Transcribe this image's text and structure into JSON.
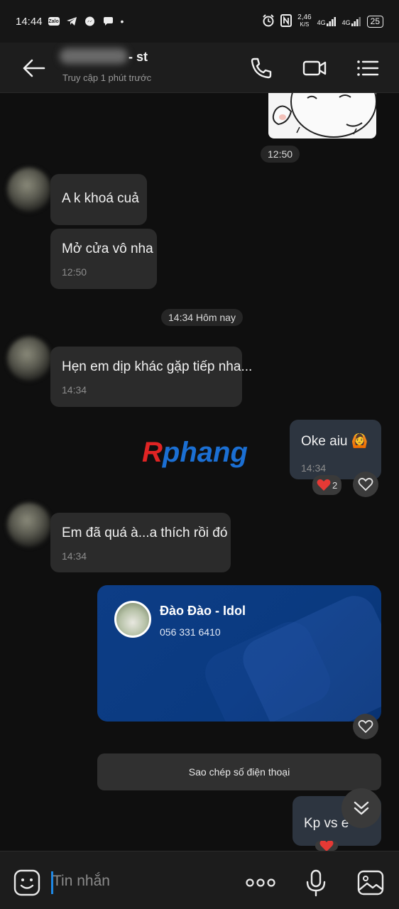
{
  "status_bar": {
    "time": "14:44",
    "net_speed_value": "2,46",
    "net_speed_unit": "K/S",
    "signal1": "4G",
    "signal2": "4G",
    "battery": "25"
  },
  "header": {
    "contact_name_suffix": "- st",
    "last_seen": "Truy cập 1 phút trước"
  },
  "messages": {
    "sticker_time": "12:50",
    "msg1_text": "A k khoá cuả",
    "msg2_text": "Mở cửa vô nha",
    "msg2_time": "12:50",
    "divider": "14:34 Hôm nay",
    "msg3_text": "Hẹn em dịp khác gặp tiếp nha...",
    "msg3_time": "14:34",
    "msg4_text": "Oke aiu",
    "msg4_emoji": "🙆",
    "msg4_time": "14:34",
    "msg4_reaction_count": "2",
    "msg5_text": "Em đã quá à...a thích rồi đó",
    "msg5_time": "14:34",
    "msg7_text": "Kp vs e"
  },
  "contact_card": {
    "name": "Đào Đào - Idol",
    "phone": "056 331 6410"
  },
  "copy_button": "Sao chép số điện thoại",
  "watermark": {
    "first": "R",
    "rest": "phang"
  },
  "input": {
    "placeholder": "Tin nhắn"
  },
  "colors": {
    "accent": "#1e88e5",
    "card_blue": "#0a3a80",
    "heart": "#e53935"
  }
}
